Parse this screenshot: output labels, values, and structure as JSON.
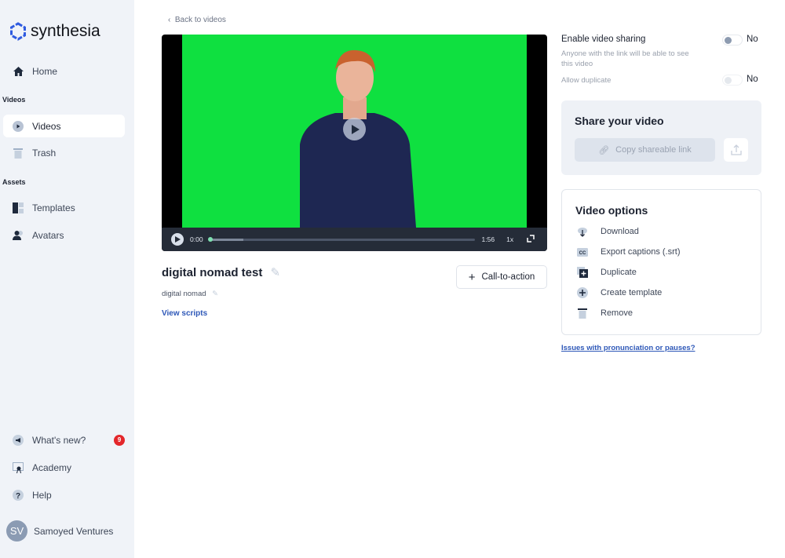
{
  "brand": {
    "name": "synthesia"
  },
  "sidebar": {
    "home": "Home",
    "videos_section": "Videos",
    "videos": "Videos",
    "trash": "Trash",
    "assets_section": "Assets",
    "templates": "Templates",
    "avatars": "Avatars",
    "whats_new": "What's new?",
    "whats_new_count": "9",
    "academy": "Academy",
    "help": "Help",
    "user_initials": "SV",
    "user_name": "Samoyed Ventures"
  },
  "main": {
    "back": "Back to videos",
    "player": {
      "current_time": "0:00",
      "duration": "1:56",
      "speed": "1x",
      "progress": 0.0,
      "buffered": 0.13
    },
    "video_title": "digital nomad test",
    "video_subtitle": "digital nomad",
    "view_scripts": "View scripts",
    "cta": "Call-to-action"
  },
  "right": {
    "sharing_label": "Enable video sharing",
    "sharing_value": "No",
    "sharing_help": "Anyone with the link will be able to see this video",
    "duplicate_label": "Allow duplicate",
    "duplicate_value": "No",
    "share_title": "Share your video",
    "copy_link": "Copy shareable link",
    "options_title": "Video options",
    "options": [
      "Download",
      "Export captions (.srt)",
      "Duplicate",
      "Create template",
      "Remove"
    ],
    "issues_link": "Issues with pronunciation or pauses?"
  },
  "colors": {
    "accent": "#2e58b8",
    "green_screen": "#0fe040",
    "badge": "#e3262b"
  }
}
